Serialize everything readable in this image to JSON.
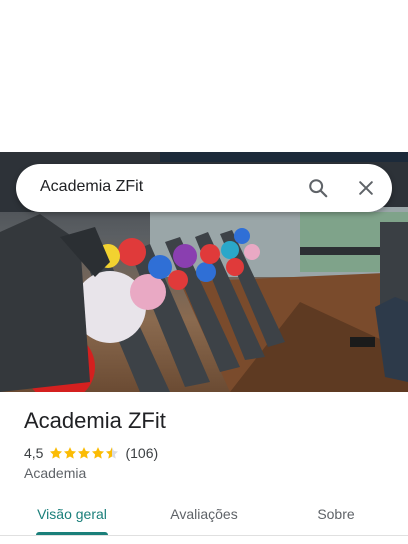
{
  "search": {
    "query": "Academia ZFit"
  },
  "place": {
    "name": "Academia ZFit",
    "rating": "4,5",
    "stars": 4.5,
    "review_count": "(106)",
    "category": "Academia"
  },
  "tabs": [
    {
      "label": "Visão geral",
      "active": true
    },
    {
      "label": "Avaliações",
      "active": false
    },
    {
      "label": "Sobre",
      "active": false
    }
  ],
  "colors": {
    "accent": "#1a7f7a",
    "star": "#fbbc04"
  }
}
